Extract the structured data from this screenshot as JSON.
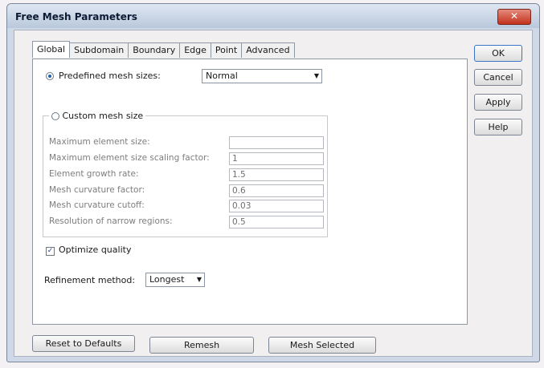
{
  "window": {
    "title": "Free Mesh Parameters",
    "close_glyph": "✕"
  },
  "tabs": [
    {
      "label": "Global"
    },
    {
      "label": "Subdomain"
    },
    {
      "label": "Boundary"
    },
    {
      "label": "Edge"
    },
    {
      "label": "Point"
    },
    {
      "label": "Advanced"
    }
  ],
  "predefined": {
    "label": "Predefined mesh sizes:",
    "value": "Normal"
  },
  "custom": {
    "label": "Custom mesh size"
  },
  "fields": [
    {
      "label": "Maximum element size:",
      "value": ""
    },
    {
      "label": "Maximum element size scaling factor:",
      "value": "1"
    },
    {
      "label": "Element growth rate:",
      "value": "1.5"
    },
    {
      "label": "Mesh curvature factor:",
      "value": "0.6"
    },
    {
      "label": "Mesh curvature cutoff:",
      "value": "0.03"
    },
    {
      "label": "Resolution of narrow regions:",
      "value": "0.5"
    }
  ],
  "optimize": {
    "label": "Optimize quality",
    "mark": "✓"
  },
  "refinement": {
    "label": "Refinement method:",
    "value": "Longest"
  },
  "side_buttons": {
    "ok": "OK",
    "cancel": "Cancel",
    "apply": "Apply",
    "help": "Help"
  },
  "bottom_buttons": {
    "reset": "Reset to Defaults",
    "remesh": "Remesh",
    "mesh_selected": "Mesh Selected"
  },
  "icons": {
    "dropdown": "▼"
  }
}
